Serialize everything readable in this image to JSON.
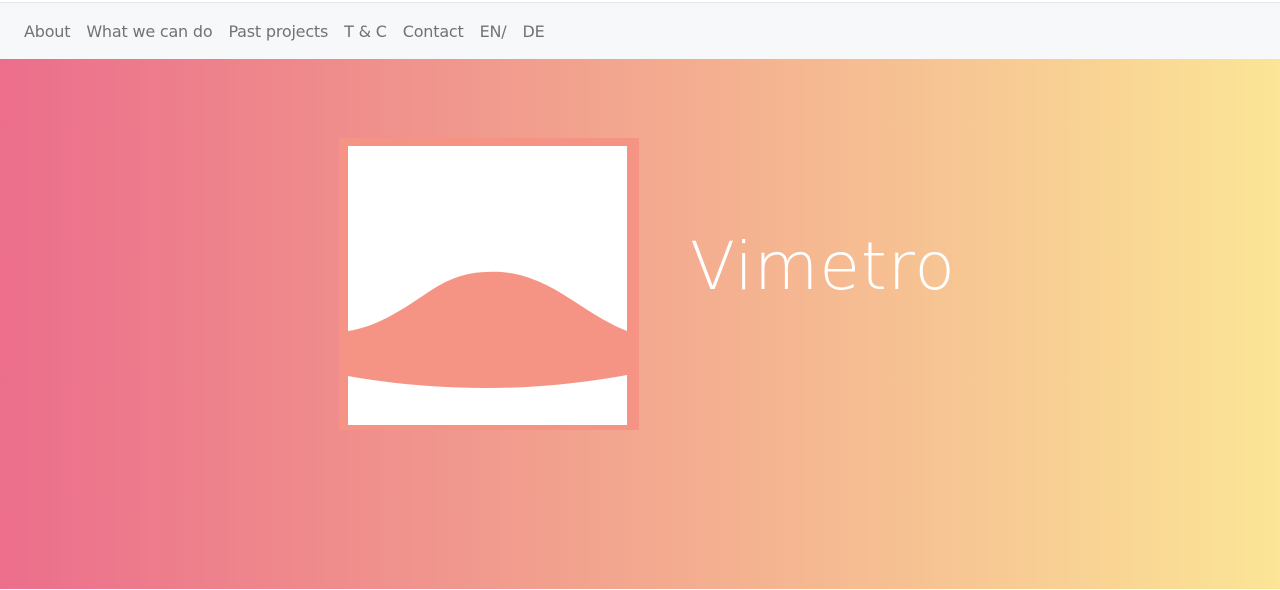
{
  "nav": {
    "items": [
      {
        "label": "About"
      },
      {
        "label": "What we can do"
      },
      {
        "label": "Past projects"
      },
      {
        "label": "T & C"
      },
      {
        "label": "Contact"
      },
      {
        "label": "EN/"
      },
      {
        "label": "DE"
      }
    ]
  },
  "hero": {
    "brand_name": "Vimetro",
    "logo_icon": "wave-logo-icon",
    "colors": {
      "gradient_start": "#ec6e8c",
      "gradient_end": "#fbe596",
      "logo_fill": "#f59484",
      "text": "#ffffff"
    }
  }
}
